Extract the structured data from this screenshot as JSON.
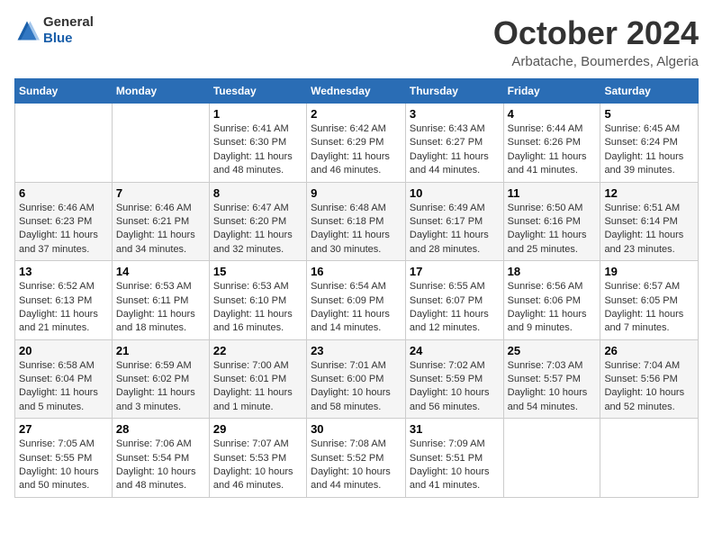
{
  "header": {
    "logo": {
      "general": "General",
      "blue": "Blue"
    },
    "title": "October 2024",
    "location": "Arbatache, Boumerdes, Algeria"
  },
  "days_of_week": [
    "Sunday",
    "Monday",
    "Tuesday",
    "Wednesday",
    "Thursday",
    "Friday",
    "Saturday"
  ],
  "weeks": [
    [
      {
        "day": "",
        "info": ""
      },
      {
        "day": "",
        "info": ""
      },
      {
        "day": "1",
        "info": "Sunrise: 6:41 AM\nSunset: 6:30 PM\nDaylight: 11 hours and 48 minutes."
      },
      {
        "day": "2",
        "info": "Sunrise: 6:42 AM\nSunset: 6:29 PM\nDaylight: 11 hours and 46 minutes."
      },
      {
        "day": "3",
        "info": "Sunrise: 6:43 AM\nSunset: 6:27 PM\nDaylight: 11 hours and 44 minutes."
      },
      {
        "day": "4",
        "info": "Sunrise: 6:44 AM\nSunset: 6:26 PM\nDaylight: 11 hours and 41 minutes."
      },
      {
        "day": "5",
        "info": "Sunrise: 6:45 AM\nSunset: 6:24 PM\nDaylight: 11 hours and 39 minutes."
      }
    ],
    [
      {
        "day": "6",
        "info": "Sunrise: 6:46 AM\nSunset: 6:23 PM\nDaylight: 11 hours and 37 minutes."
      },
      {
        "day": "7",
        "info": "Sunrise: 6:46 AM\nSunset: 6:21 PM\nDaylight: 11 hours and 34 minutes."
      },
      {
        "day": "8",
        "info": "Sunrise: 6:47 AM\nSunset: 6:20 PM\nDaylight: 11 hours and 32 minutes."
      },
      {
        "day": "9",
        "info": "Sunrise: 6:48 AM\nSunset: 6:18 PM\nDaylight: 11 hours and 30 minutes."
      },
      {
        "day": "10",
        "info": "Sunrise: 6:49 AM\nSunset: 6:17 PM\nDaylight: 11 hours and 28 minutes."
      },
      {
        "day": "11",
        "info": "Sunrise: 6:50 AM\nSunset: 6:16 PM\nDaylight: 11 hours and 25 minutes."
      },
      {
        "day": "12",
        "info": "Sunrise: 6:51 AM\nSunset: 6:14 PM\nDaylight: 11 hours and 23 minutes."
      }
    ],
    [
      {
        "day": "13",
        "info": "Sunrise: 6:52 AM\nSunset: 6:13 PM\nDaylight: 11 hours and 21 minutes."
      },
      {
        "day": "14",
        "info": "Sunrise: 6:53 AM\nSunset: 6:11 PM\nDaylight: 11 hours and 18 minutes."
      },
      {
        "day": "15",
        "info": "Sunrise: 6:53 AM\nSunset: 6:10 PM\nDaylight: 11 hours and 16 minutes."
      },
      {
        "day": "16",
        "info": "Sunrise: 6:54 AM\nSunset: 6:09 PM\nDaylight: 11 hours and 14 minutes."
      },
      {
        "day": "17",
        "info": "Sunrise: 6:55 AM\nSunset: 6:07 PM\nDaylight: 11 hours and 12 minutes."
      },
      {
        "day": "18",
        "info": "Sunrise: 6:56 AM\nSunset: 6:06 PM\nDaylight: 11 hours and 9 minutes."
      },
      {
        "day": "19",
        "info": "Sunrise: 6:57 AM\nSunset: 6:05 PM\nDaylight: 11 hours and 7 minutes."
      }
    ],
    [
      {
        "day": "20",
        "info": "Sunrise: 6:58 AM\nSunset: 6:04 PM\nDaylight: 11 hours and 5 minutes."
      },
      {
        "day": "21",
        "info": "Sunrise: 6:59 AM\nSunset: 6:02 PM\nDaylight: 11 hours and 3 minutes."
      },
      {
        "day": "22",
        "info": "Sunrise: 7:00 AM\nSunset: 6:01 PM\nDaylight: 11 hours and 1 minute."
      },
      {
        "day": "23",
        "info": "Sunrise: 7:01 AM\nSunset: 6:00 PM\nDaylight: 10 hours and 58 minutes."
      },
      {
        "day": "24",
        "info": "Sunrise: 7:02 AM\nSunset: 5:59 PM\nDaylight: 10 hours and 56 minutes."
      },
      {
        "day": "25",
        "info": "Sunrise: 7:03 AM\nSunset: 5:57 PM\nDaylight: 10 hours and 54 minutes."
      },
      {
        "day": "26",
        "info": "Sunrise: 7:04 AM\nSunset: 5:56 PM\nDaylight: 10 hours and 52 minutes."
      }
    ],
    [
      {
        "day": "27",
        "info": "Sunrise: 7:05 AM\nSunset: 5:55 PM\nDaylight: 10 hours and 50 minutes."
      },
      {
        "day": "28",
        "info": "Sunrise: 7:06 AM\nSunset: 5:54 PM\nDaylight: 10 hours and 48 minutes."
      },
      {
        "day": "29",
        "info": "Sunrise: 7:07 AM\nSunset: 5:53 PM\nDaylight: 10 hours and 46 minutes."
      },
      {
        "day": "30",
        "info": "Sunrise: 7:08 AM\nSunset: 5:52 PM\nDaylight: 10 hours and 44 minutes."
      },
      {
        "day": "31",
        "info": "Sunrise: 7:09 AM\nSunset: 5:51 PM\nDaylight: 10 hours and 41 minutes."
      },
      {
        "day": "",
        "info": ""
      },
      {
        "day": "",
        "info": ""
      }
    ]
  ]
}
